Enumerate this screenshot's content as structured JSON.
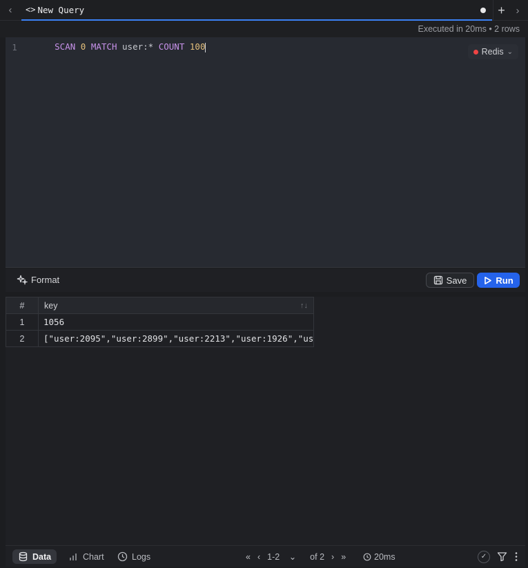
{
  "tabs": [
    {
      "code_icon": "<>",
      "title": "New Query",
      "unsaved": true
    }
  ],
  "status": {
    "summary": "Executed in 20ms • 2 rows"
  },
  "editor": {
    "line_number": "1",
    "tokens": [
      {
        "text": "SCAN",
        "kind": "kw"
      },
      {
        "text": " ",
        "kind": "txt"
      },
      {
        "text": "0",
        "kind": "num"
      },
      {
        "text": " ",
        "kind": "txt"
      },
      {
        "text": "MATCH",
        "kind": "kw"
      },
      {
        "text": " user:* ",
        "kind": "txt"
      },
      {
        "text": "COUNT",
        "kind": "kw"
      },
      {
        "text": " ",
        "kind": "txt"
      },
      {
        "text": "100",
        "kind": "num"
      }
    ],
    "db_label": "Redis",
    "db_status_color": "#ef4444"
  },
  "toolbar": {
    "format_label": "Format",
    "save_label": "Save",
    "run_label": "Run",
    "run_color": "#2563eb"
  },
  "results": {
    "columns": [
      "#",
      "key"
    ],
    "rows": [
      {
        "index": "1",
        "key": "1056"
      },
      {
        "index": "2",
        "key": "[\"user:2095\",\"user:2899\",\"user:2213\",\"user:1926\",\"us…"
      }
    ]
  },
  "footer": {
    "views": [
      "Data",
      "Chart",
      "Logs"
    ],
    "active_view": "Data",
    "page_range": "1-2",
    "page_total": "of 2",
    "timing": "20ms"
  }
}
